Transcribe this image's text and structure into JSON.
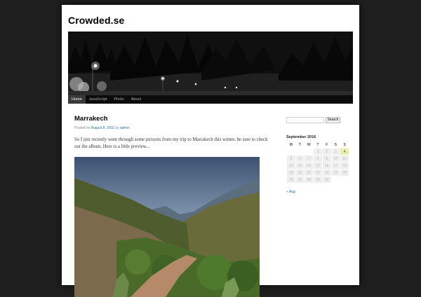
{
  "site": {
    "title": "Crowded.se"
  },
  "menu": {
    "items": [
      "Home",
      "JavaScript",
      "Photo",
      "About"
    ]
  },
  "post": {
    "title": "Marrakech",
    "meta_prefix": "Posted on",
    "date": "August 8, 2011",
    "meta_by": "by",
    "author": "admin",
    "body": "So I just recently went through some pictures from my trip to Marrakech this winter, be sure to check out the album. Here is a little preview..."
  },
  "sidebar": {
    "search_placeholder": "",
    "search_button": "Search",
    "calendar": {
      "caption": "September 2016",
      "days": [
        "M",
        "T",
        "W",
        "T",
        "F",
        "S",
        "S"
      ],
      "weeks": [
        [
          "",
          "",
          "",
          "1",
          "2",
          "3",
          "4"
        ],
        [
          "5",
          "6",
          "7",
          "8",
          "9",
          "10",
          "11"
        ],
        [
          "12",
          "13",
          "14",
          "15",
          "16",
          "17",
          "18"
        ],
        [
          "19",
          "20",
          "21",
          "22",
          "23",
          "24",
          "25"
        ],
        [
          "26",
          "27",
          "28",
          "29",
          "30",
          "",
          ""
        ]
      ],
      "today": "4",
      "prev_link": "« Aug"
    }
  },
  "colors": {
    "link": "#21759b",
    "today_bg": "#e6efa5",
    "menu_bg": "#0b0b0b"
  }
}
